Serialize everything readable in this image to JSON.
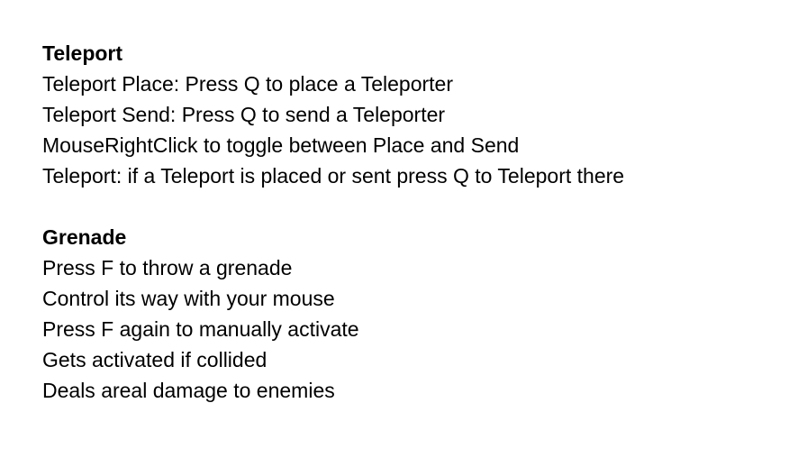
{
  "document": {
    "sections": [
      {
        "heading": "Teleport",
        "lines": [
          "Teleport Place: Press Q to place a Teleporter",
          "Teleport Send: Press Q to send a Teleporter",
          "MouseRightClick to toggle between Place and Send",
          "Teleport: if a Teleport is placed or sent press Q to Teleport there"
        ]
      },
      {
        "heading": "Grenade",
        "lines": [
          "Press F to throw a grenade",
          "Control its way with your mouse",
          "Press F again to manually activate",
          "Gets activated if collided",
          "Deals areal damage to enemies"
        ]
      }
    ]
  }
}
